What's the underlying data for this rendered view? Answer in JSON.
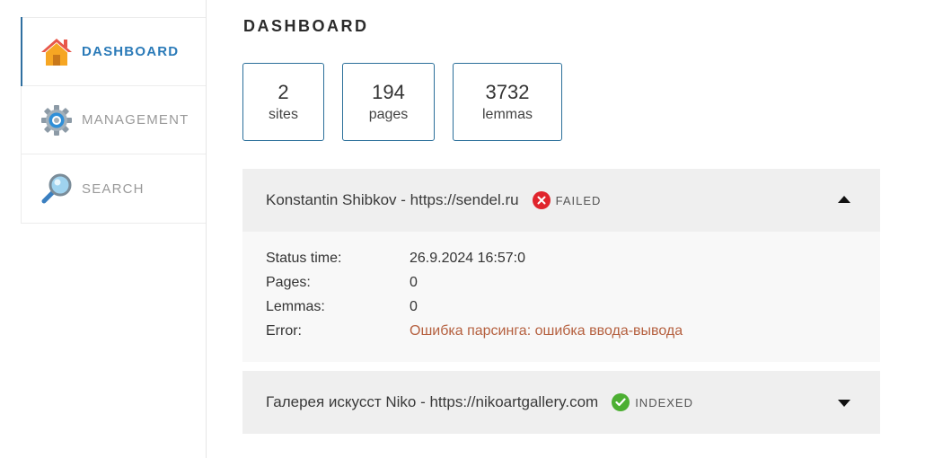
{
  "sidebar": {
    "items": [
      {
        "label": "DASHBOARD",
        "icon": "home-icon",
        "active": true
      },
      {
        "label": "MANAGEMENT",
        "icon": "gear-icon",
        "active": false
      },
      {
        "label": "SEARCH",
        "icon": "magnifier-icon",
        "active": false
      }
    ]
  },
  "main": {
    "title": "DASHBOARD",
    "stats": [
      {
        "value": "2",
        "label": "sites"
      },
      {
        "value": "194",
        "label": "pages"
      },
      {
        "value": "3732",
        "label": "lemmas"
      }
    ],
    "sites": [
      {
        "name": "Konstantin Shibkov - https://sendel.ru",
        "status": "FAILED",
        "status_color": "#e0242c",
        "expanded": true,
        "details": [
          {
            "key": "Status time:",
            "value": "26.9.2024 16:57:0"
          },
          {
            "key": "Pages:",
            "value": "0"
          },
          {
            "key": "Lemmas:",
            "value": "0"
          },
          {
            "key": "Error:",
            "value": "Ошибка парсинга: ошибка ввода-вывода"
          }
        ]
      },
      {
        "name": "Галерея искусст Niko - https://nikoartgallery.com",
        "status": "INDEXED",
        "status_color": "#4caf32",
        "expanded": false
      }
    ]
  },
  "colors": {
    "accent": "#2a7ab8",
    "card_border": "#2b6f9a",
    "error_text": "#b5603f"
  }
}
